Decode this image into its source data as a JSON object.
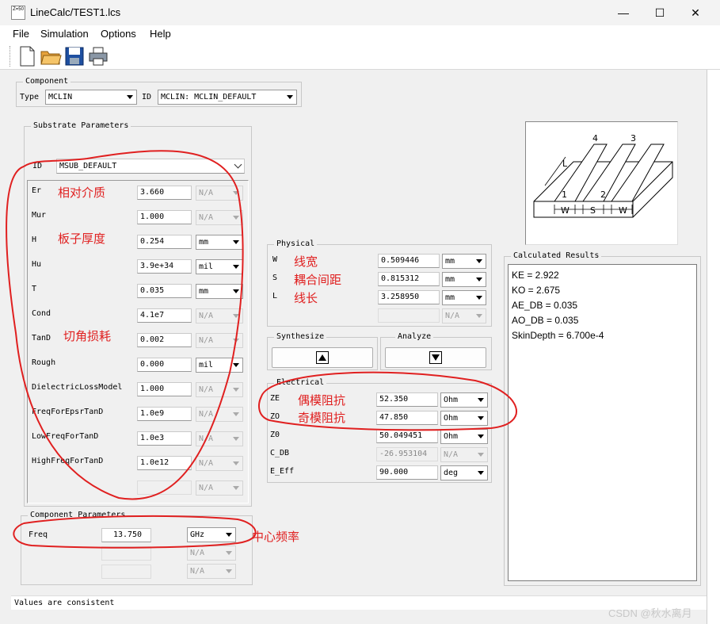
{
  "window": {
    "title": "LineCalc/TEST1.lcs",
    "icon_text": "Z=50"
  },
  "menu": [
    "File",
    "Simulation",
    "Options",
    "Help"
  ],
  "component": {
    "label": "Component",
    "type_label": "Type",
    "type_value": "MCLIN",
    "id_label": "ID",
    "id_value": "MCLIN: MCLIN_DEFAULT"
  },
  "substrate": {
    "label": "Substrate Parameters",
    "id_label": "ID",
    "id_value": "MSUB_DEFAULT",
    "params": [
      {
        "name": "Er",
        "value": "3.660",
        "unit": "N/A",
        "unit_enabled": false
      },
      {
        "name": "Mur",
        "value": "1.000",
        "unit": "N/A",
        "unit_enabled": false
      },
      {
        "name": "H",
        "value": "0.254",
        "unit": "mm",
        "unit_enabled": true
      },
      {
        "name": "Hu",
        "value": "3.9e+34",
        "unit": "mil",
        "unit_enabled": true
      },
      {
        "name": "T",
        "value": "0.035",
        "unit": "mm",
        "unit_enabled": true
      },
      {
        "name": "Cond",
        "value": "4.1e7",
        "unit": "N/A",
        "unit_enabled": false
      },
      {
        "name": "TanD",
        "value": "0.002",
        "unit": "N/A",
        "unit_enabled": false
      },
      {
        "name": "Rough",
        "value": "0.000",
        "unit": "mil",
        "unit_enabled": true
      },
      {
        "name": "DielectricLossModel",
        "value": "1.000",
        "unit": "N/A",
        "unit_enabled": false
      },
      {
        "name": "FreqForEpsrTanD",
        "value": "1.0e9",
        "unit": "N/A",
        "unit_enabled": false
      },
      {
        "name": "LowFreqForTanD",
        "value": "1.0e3",
        "unit": "N/A",
        "unit_enabled": false
      },
      {
        "name": "HighFreqForTanD",
        "value": "1.0e12",
        "unit": "N/A",
        "unit_enabled": false
      },
      {
        "name": "",
        "value": "",
        "unit": "N/A",
        "unit_enabled": false
      }
    ]
  },
  "comp_params": {
    "label": "Component Parameters",
    "freq_label": "Freq",
    "freq_value": "13.750",
    "freq_unit": "GHz",
    "extra_unit_1": "N/A",
    "extra_unit_2": "N/A"
  },
  "physical": {
    "label": "Physical",
    "params": [
      {
        "name": "W",
        "value": "0.509446",
        "unit": "mm",
        "enabled": true
      },
      {
        "name": "S",
        "value": "0.815312",
        "unit": "mm",
        "enabled": true
      },
      {
        "name": "L",
        "value": "3.258950",
        "unit": "mm",
        "enabled": true
      },
      {
        "name": "",
        "value": "",
        "unit": "N/A",
        "enabled": false
      }
    ]
  },
  "synthesize": {
    "label": "Synthesize"
  },
  "analyze": {
    "label": "Analyze"
  },
  "electrical": {
    "label": "Electrical",
    "params": [
      {
        "name": "ZE",
        "value": "52.350",
        "unit": "Ohm",
        "enabled": true
      },
      {
        "name": "ZO",
        "value": "47.850",
        "unit": "Ohm",
        "enabled": true
      },
      {
        "name": "Z0",
        "value": "50.049451",
        "unit": "Ohm",
        "enabled": true
      },
      {
        "name": "C_DB",
        "value": "-26.953104",
        "unit": "N/A",
        "enabled": false
      },
      {
        "name": "E_Eff",
        "value": "90.000",
        "unit": "deg",
        "enabled": true
      }
    ]
  },
  "diagram": {
    "labels": [
      "L",
      "1",
      "2",
      "3",
      "4",
      "W",
      "S",
      "W"
    ]
  },
  "results": {
    "label": "Calculated Results",
    "lines": [
      "KE = 2.922",
      "KO = 2.675",
      "AE_DB = 0.035",
      "AO_DB = 0.035",
      "SkinDepth = 6.700e-4"
    ]
  },
  "status": "Values are consistent",
  "annotations": {
    "er": "相对介质",
    "h": "板子厚度",
    "tand": "切角损耗",
    "w": "线宽",
    "s": "耦合间距",
    "l": "线长",
    "ze": "偶模阻抗",
    "zo": "奇模阻抗",
    "freq": "中心频率"
  },
  "watermark": "CSDN @秋水离月",
  "colors": {
    "annotation": "#e02020",
    "save_icon": "#1e4fa0"
  }
}
